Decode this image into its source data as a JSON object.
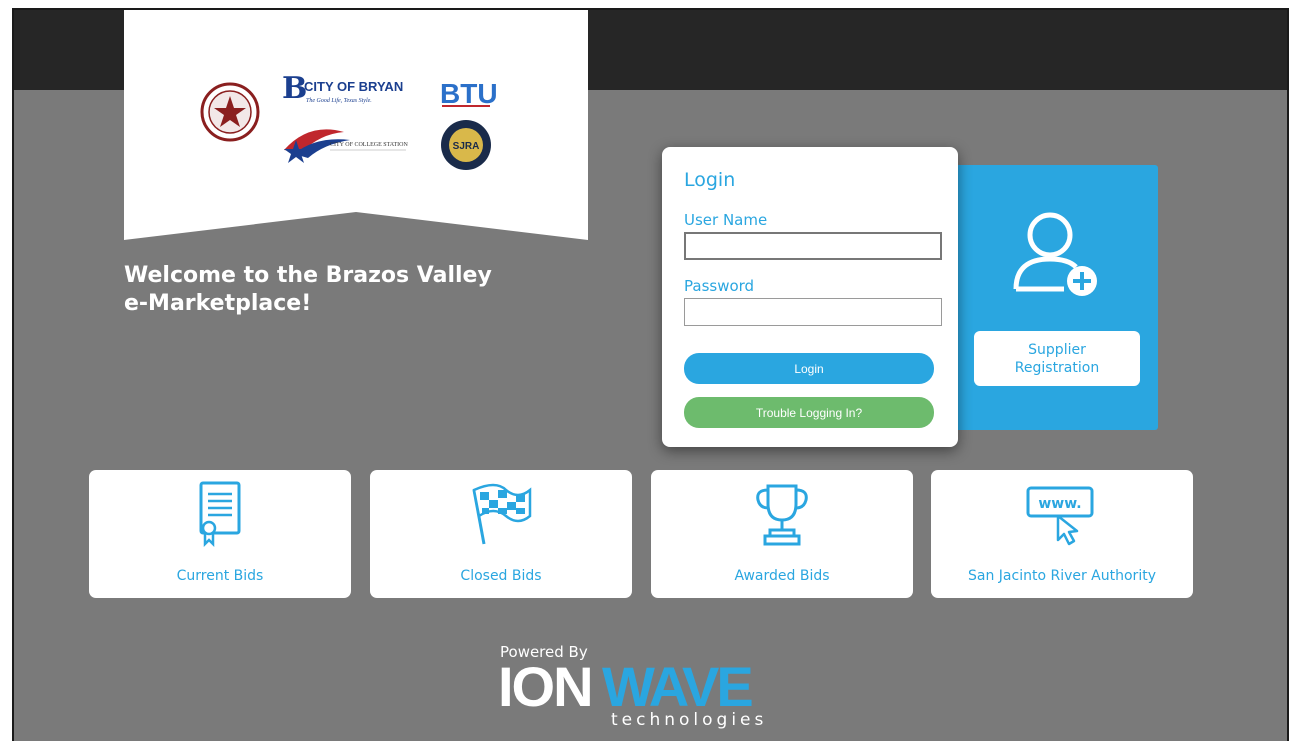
{
  "banner": {
    "logos": [
      "county-seal",
      "city-of-bryan",
      "btu",
      "city-of-college-station",
      "sjra"
    ],
    "city_of_bryan": "CITY OF BRYAN",
    "city_of_bryan_tagline": "The Good Life, Texas Style.",
    "btu": "BTU",
    "college_station": "CITY OF COLLEGE STATION",
    "sjra": "SJRA"
  },
  "welcome": {
    "line1": "Welcome to the Brazos Valley",
    "line2": "e-Marketplace!"
  },
  "login": {
    "title": "Login",
    "username_label": "User Name",
    "username_value": "",
    "password_label": "Password",
    "password_value": "",
    "login_button": "Login",
    "trouble_button": "Trouble Logging In?"
  },
  "supplier": {
    "line1": "Supplier",
    "line2": "Registration",
    "icon": "user-add-icon"
  },
  "tiles": [
    {
      "label": "Current Bids",
      "icon": "document-certificate-icon"
    },
    {
      "label": "Closed Bids",
      "icon": "checkered-flag-icon"
    },
    {
      "label": "Awarded Bids",
      "icon": "trophy-icon"
    },
    {
      "label": "San Jacinto River Authority",
      "icon": "www-cursor-icon"
    }
  ],
  "footer": {
    "powered_by": "Powered By",
    "brand_ion": "ION",
    "brand_wave": "WAVE",
    "brand_sub": "technologies"
  },
  "colors": {
    "accent": "#2aa6e0",
    "green": "#6dbb6d",
    "background": "#7a7a7a",
    "topbar": "#262626"
  }
}
